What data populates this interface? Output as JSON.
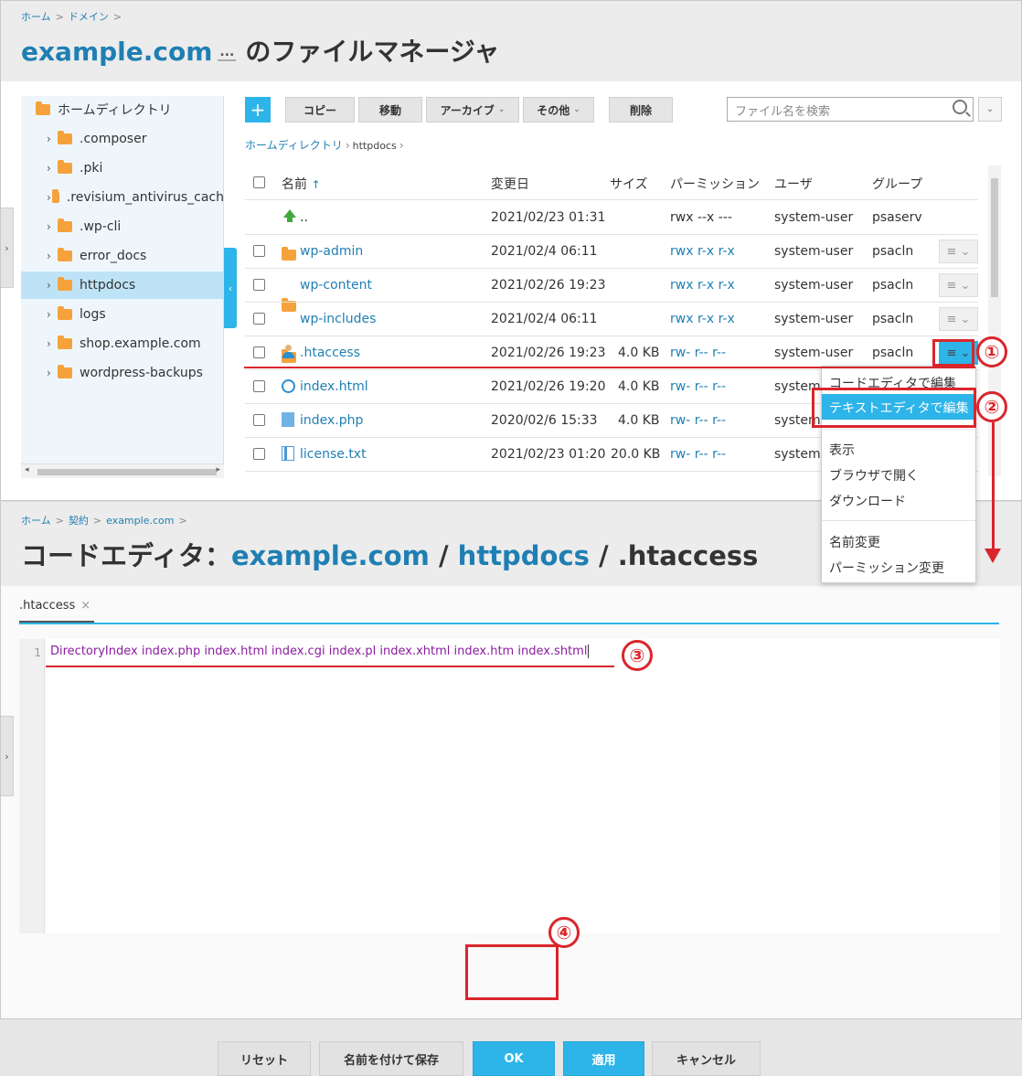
{
  "file_manager": {
    "breadcrumbs": [
      "ホーム",
      "ドメイン"
    ],
    "title_domain": "example.com",
    "title_more": "...",
    "title_suffix": "のファイルマネージャ",
    "toolbar": {
      "add": "+",
      "copy": "コピー",
      "move": "移動",
      "archive": "アーカイブ",
      "other": "その他",
      "delete": "削除",
      "search_placeholder": "ファイル名を検索"
    },
    "path": {
      "root": "ホームディレクトリ",
      "current": "httpdocs"
    },
    "tree": {
      "root": "ホームディレクトリ",
      "items": [
        ".composer",
        ".pki",
        ".revisium_antivirus_cach",
        ".wp-cli",
        "error_docs",
        "httpdocs",
        "logs",
        "shop.example.com",
        "wordpress-backups"
      ],
      "selected": "httpdocs"
    },
    "columns": {
      "name": "名前",
      "sort": "↑",
      "modified": "変更日",
      "size": "サイズ",
      "perm": "パーミッション",
      "user": "ユーザ",
      "group": "グループ"
    },
    "rows": [
      {
        "name": "..",
        "modified": "2021/02/23 01:31",
        "size": "",
        "perm": "rwx --x ---",
        "user": "system-user",
        "group": "psaserv"
      },
      {
        "name": "wp-admin",
        "modified": "2021/02/4 06:11",
        "size": "",
        "perm": "rwx r-x r-x",
        "user": "system-user",
        "group": "psacln"
      },
      {
        "name": "wp-content",
        "modified": "2021/02/26 19:23",
        "size": "",
        "perm": "rwx r-x r-x",
        "user": "system-user",
        "group": "psacln"
      },
      {
        "name": "wp-includes",
        "modified": "2021/02/4 06:11",
        "size": "",
        "perm": "rwx r-x r-x",
        "user": "system-user",
        "group": "psacln"
      },
      {
        "name": ".htaccess",
        "modified": "2021/02/26 19:23",
        "size": "4.0 KB",
        "perm": "rw- r-- r--",
        "user": "system-user",
        "group": "psacln"
      },
      {
        "name": "index.html",
        "modified": "2021/02/26 19:20",
        "size": "4.0 KB",
        "perm": "rw- r-- r--",
        "user": "system-",
        "group": ""
      },
      {
        "name": "index.php",
        "modified": "2020/02/6 15:33",
        "size": "4.0 KB",
        "perm": "rw- r-- r--",
        "user": "system-",
        "group": ""
      },
      {
        "name": "license.txt",
        "modified": "2021/02/23 01:20",
        "size": "20.0 KB",
        "perm": "rw- r-- r--",
        "user": "system-",
        "group": ""
      }
    ]
  },
  "context_menu": {
    "items": [
      "コードエディタで編集",
      "テキストエディタで編集",
      "表示",
      "ブラウザで開く",
      "ダウンロード",
      "名前変更",
      "パーミッション変更"
    ]
  },
  "code_editor": {
    "breadcrumbs": [
      "ホーム",
      "契約",
      "example.com"
    ],
    "title_prefix": "コードエディタ：",
    "title_domain": "example.com",
    "title_sep1": " / ",
    "title_dir": "httpdocs",
    "title_sep2": " / ",
    "title_file": ".htaccess",
    "tab_label": ".htaccess",
    "tab_close": "×",
    "line_number": "1",
    "code_line": "DirectoryIndex index.php index.html index.cgi index.pl index.xhtml index.htm index.shtml",
    "buttons": {
      "reset": "リセット",
      "save_as": "名前を付けて保存",
      "ok": "OK",
      "apply": "適用",
      "cancel": "キャンセル"
    }
  },
  "annotations": [
    "①",
    "②",
    "③",
    "④"
  ],
  "colors": {
    "accent": "#2db4e8",
    "link": "#1f7fb3",
    "annotation": "#d9262c"
  }
}
